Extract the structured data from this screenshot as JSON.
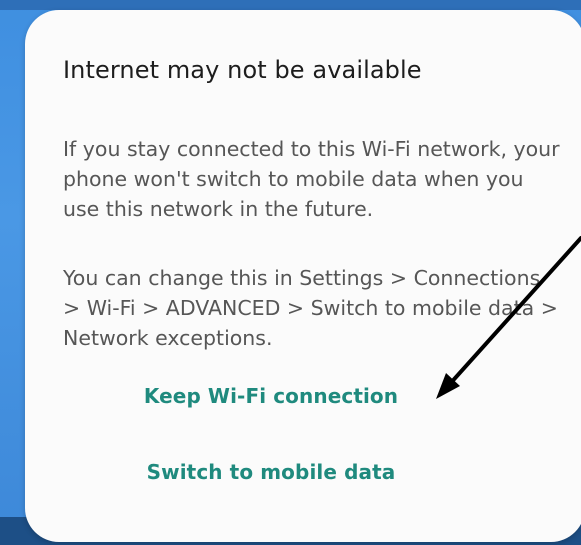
{
  "dialog": {
    "title": "Internet may not be available",
    "paragraph_1": "If you stay connected to this Wi-Fi network, your phone won't switch to mobile data when you use this network in the future.",
    "paragraph_2": "You can change this in Settings > Connections > Wi-Fi > ADVANCED > Switch to mobile data > Network exceptions.",
    "actions": [
      {
        "label": "Keep Wi-Fi connection"
      },
      {
        "label": "Switch to mobile data"
      }
    ]
  },
  "colors": {
    "accent": "#1f8a7e",
    "title": "#1d1d1d",
    "body_text": "#565656",
    "backdrop": "#4a98e5",
    "dialog_bg": "#fbfbfb",
    "annotation_arrow": "#000000"
  },
  "icons": {
    "annotation": "arrow-pointer-icon"
  }
}
